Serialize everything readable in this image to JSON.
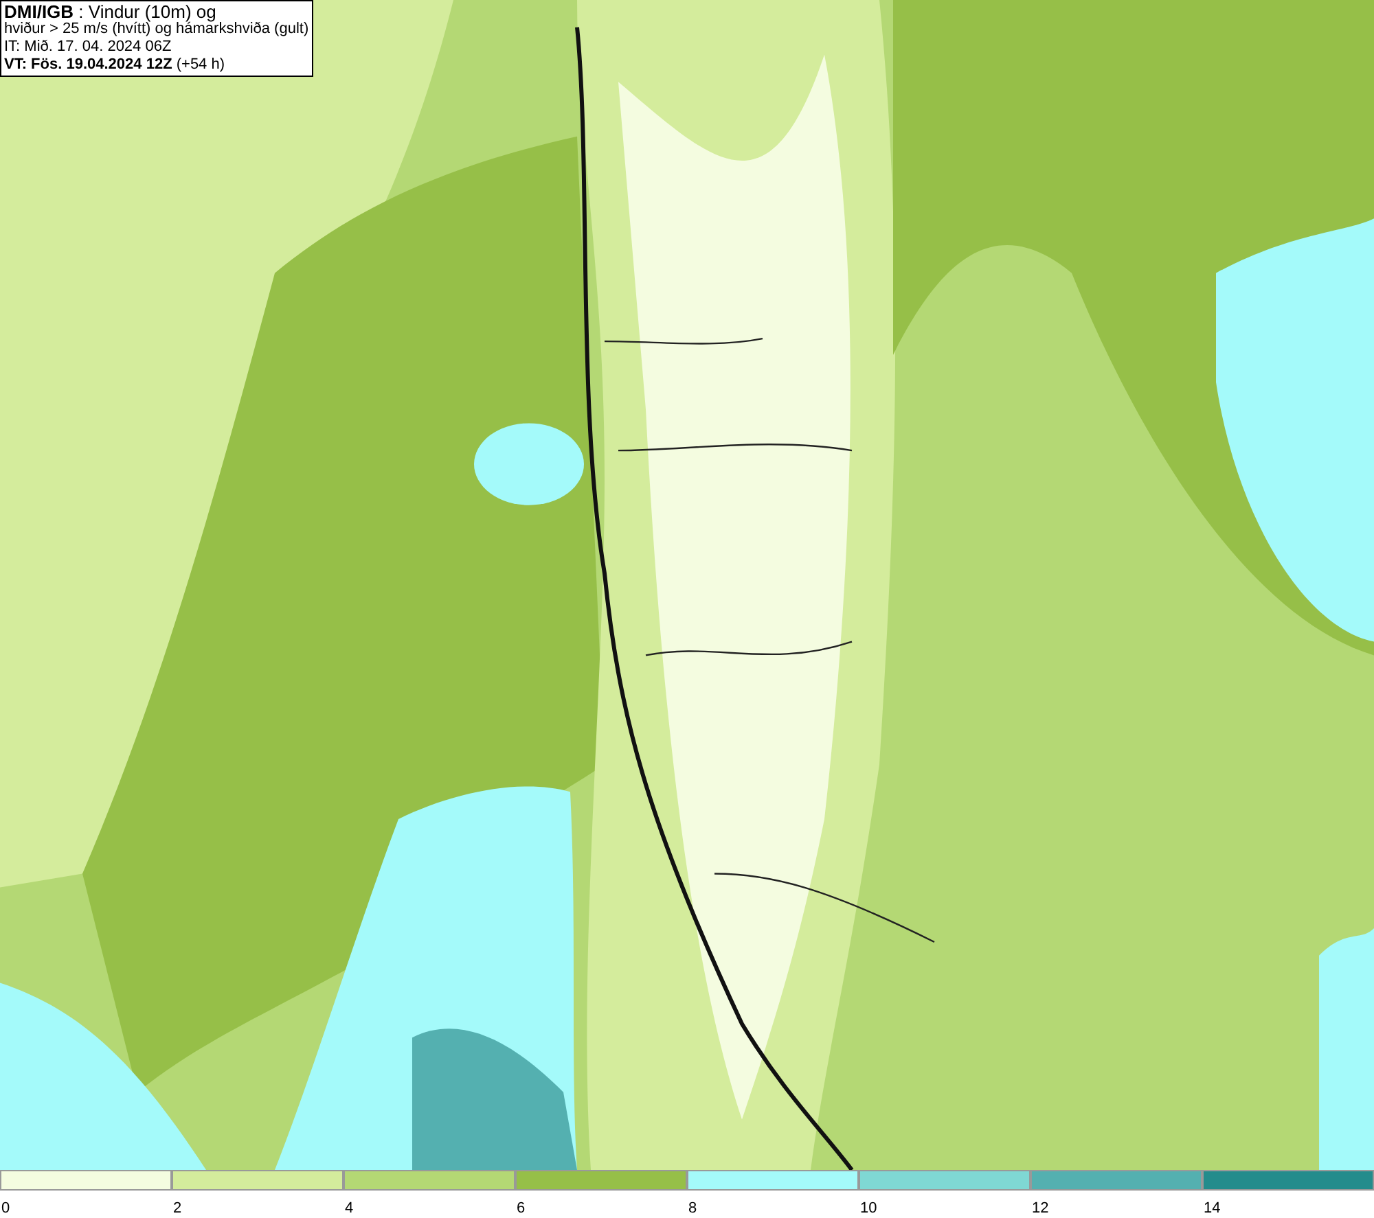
{
  "info_box": {
    "lines": [
      "**DMI/IGB** : Vindur (10m) og",
      "hviður > 25 m/s (hvítt) og hámarkshviða (gult)",
      "IT: Mið. 17. 04. 2024 06Z",
      "**VT: Fös. 19.04.2024 12Z** (+54 h)"
    ]
  },
  "legend": {
    "bins": [
      {
        "label": "0",
        "color": "#f4fce0"
      },
      {
        "label": "2",
        "color": "#d4ec9c"
      },
      {
        "label": "4",
        "color": "#b4d874"
      },
      {
        "label": "6",
        "color": "#96bf48"
      },
      {
        "label": "8",
        "color": "#a4fafa"
      },
      {
        "label": "10",
        "color": "#7fd8d4"
      },
      {
        "label": "12",
        "color": "#54b0b0"
      },
      {
        "label": "14",
        "color": "#238c8c"
      }
    ]
  }
}
